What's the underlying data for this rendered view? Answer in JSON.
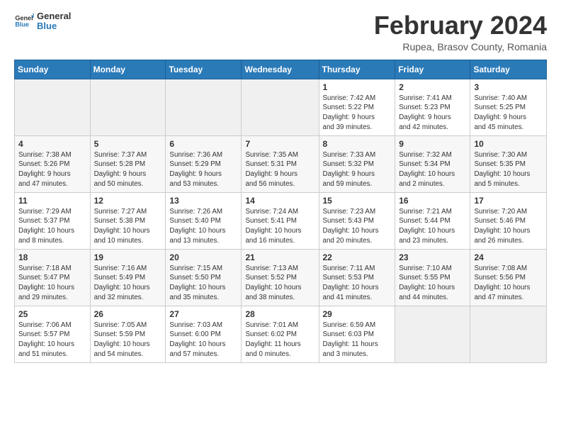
{
  "header": {
    "logo": {
      "general": "General",
      "blue": "Blue"
    },
    "title": "February 2024",
    "subtitle": "Rupea, Brasov County, Romania"
  },
  "calendar": {
    "days_of_week": [
      "Sunday",
      "Monday",
      "Tuesday",
      "Wednesday",
      "Thursday",
      "Friday",
      "Saturday"
    ],
    "weeks": [
      [
        {
          "day": "",
          "info": ""
        },
        {
          "day": "",
          "info": ""
        },
        {
          "day": "",
          "info": ""
        },
        {
          "day": "",
          "info": ""
        },
        {
          "day": "1",
          "info": "Sunrise: 7:42 AM\nSunset: 5:22 PM\nDaylight: 9 hours\nand 39 minutes."
        },
        {
          "day": "2",
          "info": "Sunrise: 7:41 AM\nSunset: 5:23 PM\nDaylight: 9 hours\nand 42 minutes."
        },
        {
          "day": "3",
          "info": "Sunrise: 7:40 AM\nSunset: 5:25 PM\nDaylight: 9 hours\nand 45 minutes."
        }
      ],
      [
        {
          "day": "4",
          "info": "Sunrise: 7:38 AM\nSunset: 5:26 PM\nDaylight: 9 hours\nand 47 minutes."
        },
        {
          "day": "5",
          "info": "Sunrise: 7:37 AM\nSunset: 5:28 PM\nDaylight: 9 hours\nand 50 minutes."
        },
        {
          "day": "6",
          "info": "Sunrise: 7:36 AM\nSunset: 5:29 PM\nDaylight: 9 hours\nand 53 minutes."
        },
        {
          "day": "7",
          "info": "Sunrise: 7:35 AM\nSunset: 5:31 PM\nDaylight: 9 hours\nand 56 minutes."
        },
        {
          "day": "8",
          "info": "Sunrise: 7:33 AM\nSunset: 5:32 PM\nDaylight: 9 hours\nand 59 minutes."
        },
        {
          "day": "9",
          "info": "Sunrise: 7:32 AM\nSunset: 5:34 PM\nDaylight: 10 hours\nand 2 minutes."
        },
        {
          "day": "10",
          "info": "Sunrise: 7:30 AM\nSunset: 5:35 PM\nDaylight: 10 hours\nand 5 minutes."
        }
      ],
      [
        {
          "day": "11",
          "info": "Sunrise: 7:29 AM\nSunset: 5:37 PM\nDaylight: 10 hours\nand 8 minutes."
        },
        {
          "day": "12",
          "info": "Sunrise: 7:27 AM\nSunset: 5:38 PM\nDaylight: 10 hours\nand 10 minutes."
        },
        {
          "day": "13",
          "info": "Sunrise: 7:26 AM\nSunset: 5:40 PM\nDaylight: 10 hours\nand 13 minutes."
        },
        {
          "day": "14",
          "info": "Sunrise: 7:24 AM\nSunset: 5:41 PM\nDaylight: 10 hours\nand 16 minutes."
        },
        {
          "day": "15",
          "info": "Sunrise: 7:23 AM\nSunset: 5:43 PM\nDaylight: 10 hours\nand 20 minutes."
        },
        {
          "day": "16",
          "info": "Sunrise: 7:21 AM\nSunset: 5:44 PM\nDaylight: 10 hours\nand 23 minutes."
        },
        {
          "day": "17",
          "info": "Sunrise: 7:20 AM\nSunset: 5:46 PM\nDaylight: 10 hours\nand 26 minutes."
        }
      ],
      [
        {
          "day": "18",
          "info": "Sunrise: 7:18 AM\nSunset: 5:47 PM\nDaylight: 10 hours\nand 29 minutes."
        },
        {
          "day": "19",
          "info": "Sunrise: 7:16 AM\nSunset: 5:49 PM\nDaylight: 10 hours\nand 32 minutes."
        },
        {
          "day": "20",
          "info": "Sunrise: 7:15 AM\nSunset: 5:50 PM\nDaylight: 10 hours\nand 35 minutes."
        },
        {
          "day": "21",
          "info": "Sunrise: 7:13 AM\nSunset: 5:52 PM\nDaylight: 10 hours\nand 38 minutes."
        },
        {
          "day": "22",
          "info": "Sunrise: 7:11 AM\nSunset: 5:53 PM\nDaylight: 10 hours\nand 41 minutes."
        },
        {
          "day": "23",
          "info": "Sunrise: 7:10 AM\nSunset: 5:55 PM\nDaylight: 10 hours\nand 44 minutes."
        },
        {
          "day": "24",
          "info": "Sunrise: 7:08 AM\nSunset: 5:56 PM\nDaylight: 10 hours\nand 47 minutes."
        }
      ],
      [
        {
          "day": "25",
          "info": "Sunrise: 7:06 AM\nSunset: 5:57 PM\nDaylight: 10 hours\nand 51 minutes."
        },
        {
          "day": "26",
          "info": "Sunrise: 7:05 AM\nSunset: 5:59 PM\nDaylight: 10 hours\nand 54 minutes."
        },
        {
          "day": "27",
          "info": "Sunrise: 7:03 AM\nSunset: 6:00 PM\nDaylight: 10 hours\nand 57 minutes."
        },
        {
          "day": "28",
          "info": "Sunrise: 7:01 AM\nSunset: 6:02 PM\nDaylight: 11 hours\nand 0 minutes."
        },
        {
          "day": "29",
          "info": "Sunrise: 6:59 AM\nSunset: 6:03 PM\nDaylight: 11 hours\nand 3 minutes."
        },
        {
          "day": "",
          "info": ""
        },
        {
          "day": "",
          "info": ""
        }
      ]
    ]
  }
}
